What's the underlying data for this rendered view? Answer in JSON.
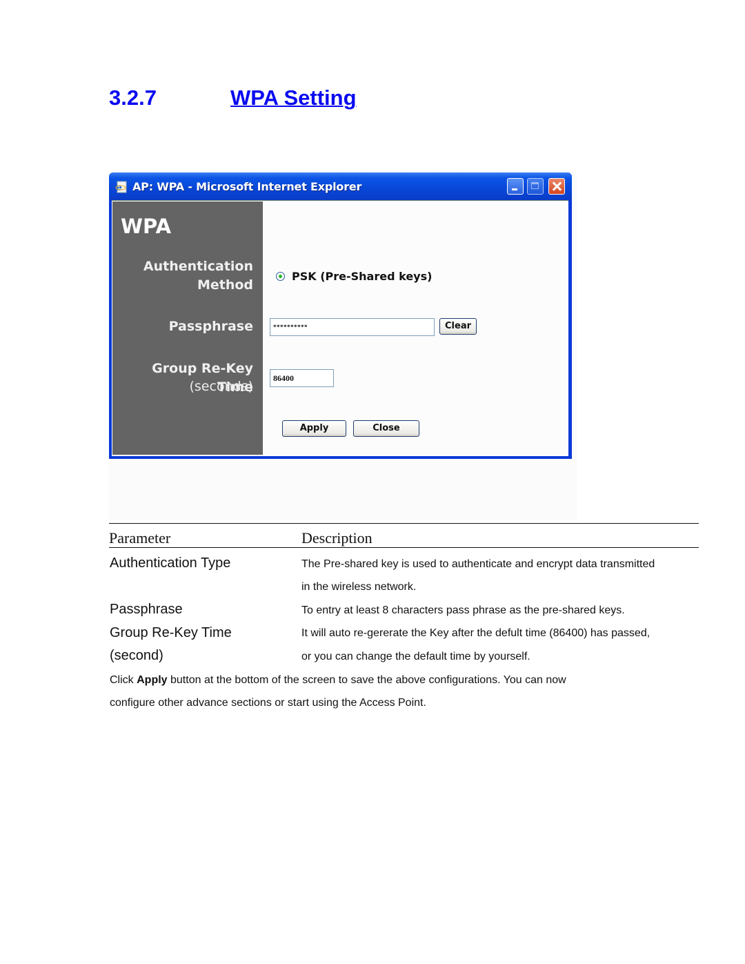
{
  "heading": {
    "number": "3.2.7",
    "title": "WPA Setting"
  },
  "window": {
    "title": "AP: WPA - Microsoft Internet Explorer",
    "icons": [
      "ie-page-icon",
      "minimize-icon",
      "maximize-icon",
      "close-icon"
    ],
    "sidebar": {
      "title": "WPA",
      "auth_line1": "Authentication",
      "auth_line2": "Method",
      "passphrase": "Passphrase",
      "rekey": "Group Re-Key Time",
      "rekey_unit": "(seconds)"
    },
    "form": {
      "auth_option": "PSK (Pre-Shared keys)",
      "auth_selected": true,
      "passphrase_value": "**********",
      "clear_label": "Clear",
      "rekey_value": "86400",
      "apply_label": "Apply",
      "close_label": "Close"
    },
    "colors": {
      "titlebar": "#0846d8",
      "sidebar": "#646464",
      "radio_dot": "#26b526",
      "close_button": "#d4441e"
    }
  },
  "table": {
    "headers": [
      "Parameter",
      "Description"
    ],
    "rows": [
      {
        "param": "Authentication Type",
        "desc": [
          "The Pre-shared key is used to authenticate and encrypt data transmitted",
          "in the wireless network."
        ]
      },
      {
        "param": "Passphrase",
        "desc": [
          "To entry at least 8 characters pass phrase as the pre-shared keys."
        ]
      },
      {
        "param": "Group Re-Key Time",
        "param2": "(second)",
        "desc": [
          "It will auto re-gererate the Key after the defult time (86400) has passed,",
          "or you can change the default time by yourself."
        ]
      }
    ]
  },
  "footer": {
    "prefix": "Click ",
    "bold": "Apply",
    "line1_rest": " button at the bottom of the screen to save the above configurations. You can now",
    "line2": "configure other advance sections or start using the Access Point."
  },
  "heading_color": "#0a0af0"
}
